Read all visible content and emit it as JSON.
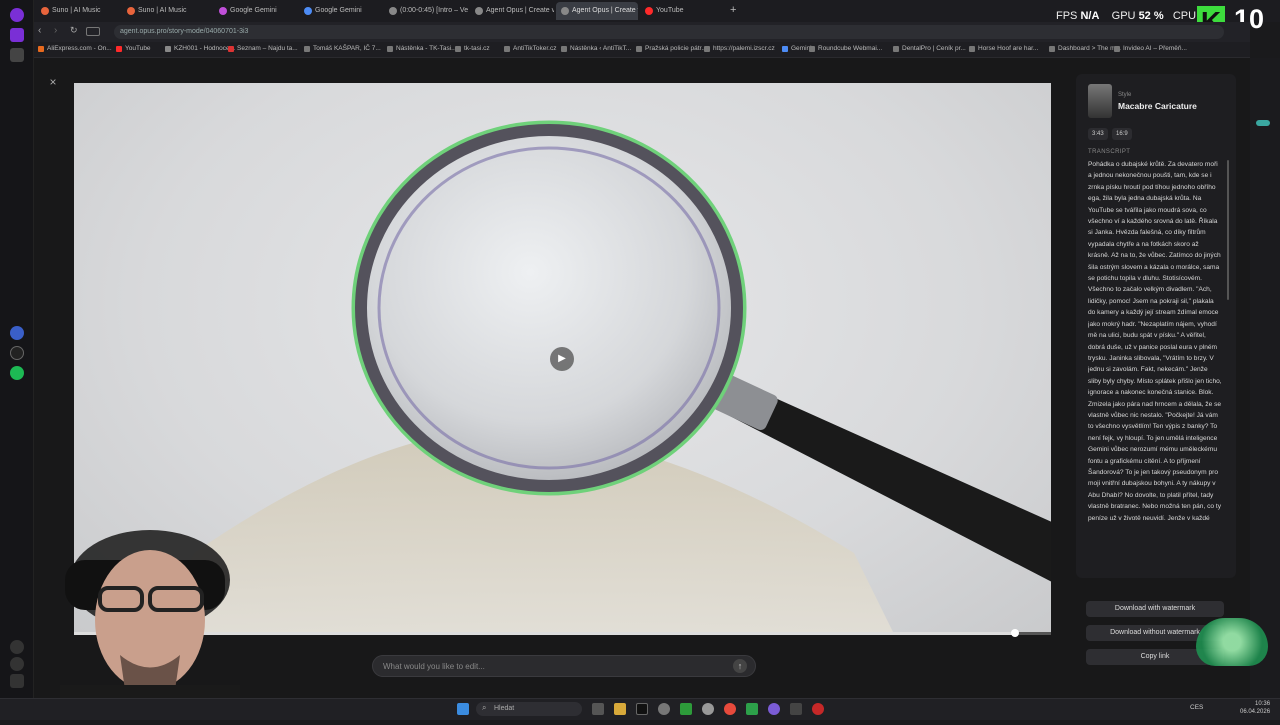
{
  "browser": {
    "tabs": [
      {
        "label": "Suno | AI Music",
        "color": "#e8643c"
      },
      {
        "label": "Suno | AI Music",
        "color": "#e8643c"
      },
      {
        "label": "Google Gemini",
        "color": "#c04fd9"
      },
      {
        "label": "Google Gemini",
        "color": "#4d8cf5"
      },
      {
        "label": "(0:00-0:45) [Intro – Vese]",
        "color": "#888"
      },
      {
        "label": "Agent Opus | Create vide",
        "color": "#888"
      },
      {
        "label": "Agent Opus | Create vide",
        "color": "#888"
      },
      {
        "label": "YouTube",
        "color": "#ff2a2a"
      }
    ],
    "url": "agent.opus.pro/story-mode/04060701-3i3",
    "bookmarks": [
      {
        "label": "AliExpress.com - On...",
        "color": "#e86a1e"
      },
      {
        "label": "YouTube",
        "color": "#ff2a2a"
      },
      {
        "label": "KZH001 - Hodnoce...",
        "color": "#888"
      },
      {
        "label": "Seznam – Najdu ta...",
        "color": "#d33"
      },
      {
        "label": "Tomáš KAŠPAR, IČ 7...",
        "color": "#777"
      },
      {
        "label": "Nástěnka - TK-Tasi...",
        "color": "#777"
      },
      {
        "label": "tk-tasi.cz",
        "color": "#777"
      },
      {
        "label": "AntiTikToker.cz",
        "color": "#777"
      },
      {
        "label": "Nástěnka ‹ AntiTikT...",
        "color": "#777"
      },
      {
        "label": "Pražská policie pátr...",
        "color": "#777"
      },
      {
        "label": "https://palemi.izscr.cz",
        "color": "#777"
      },
      {
        "label": "Gemini",
        "color": "#4d8cf5"
      },
      {
        "label": "Roundcube Webmai...",
        "color": "#777"
      },
      {
        "label": "DentalPro | Ceník pr...",
        "color": "#777"
      },
      {
        "label": "Horse Hoof are har...",
        "color": "#777"
      },
      {
        "label": "Dashboard > The m...",
        "color": "#777"
      },
      {
        "label": "Invideo AI – Přeměň...",
        "color": "#777"
      }
    ]
  },
  "hud": {
    "fps_label": "FPS",
    "fps_value": "N/A",
    "gpu_label": "GPU",
    "gpu_value": "52 %",
    "cpu_label": "CPU",
    "logo_letter": "K",
    "logo_number": "10"
  },
  "modal": {
    "close": "×",
    "play_icon": "play-icon",
    "progress": 0.963,
    "edit_placeholder": "What would you like to edit...",
    "send": "↑"
  },
  "sidebar": {
    "style_label": "Style",
    "style_name": "Macabre Caricature",
    "duration": "3:43",
    "ratio": "16:9",
    "transcript_label": "TRANSCRIPT",
    "transcript": "Pohádka o dubajské krůtě. Za devatero moři a jednou nekonečnou poušti, tam, kde se i zrnka písku hroutí pod tíhou jednoho obřího ega, žila byla jedna dubajská krůta. Na YouTube se tvářila jako moudrá sova, co všechno ví a každého srovná do latě. Říkala si Janka. Hvězda falešná, co díky filtrům vypadala chytře a na fotkách skoro až krásně. Až na to, že vůbec. Zatímco do jiných šila ostrým slovem a kázala o morálce, sama se potichu topila v dluhu. Stotisícovém. Všechno to začalo velkým divadlem. \"Ach, lidičky, pomoc! Jsem na pokraji sil,\" plakala do kamery a každý její stream ždímal emoce jako mokrý hadr. \"Nezaplatím nájem, vyhodí mě na ulici, budu spát v písku.\" A věřitel, dobrá duše, už v panice poslal eura v plném trysku. Janinka slibovala, \"Vrátím to brzy. V jednu si zavolám. Fakt, nekecám.\" Jenže sliby byly chyby. Místo splátek přišlo jen ticho, ignorace a nakonec konečná stanice. Blok. Zmizela jako pára nad hrncem a dělala, že se vlastně vůbec nic nestalo. \"Počkejte! Já vám to všechno vysvětlím! Ten výpis z banky? To není fejk, vy hloupí. To jen umělá inteligence Gemini vůbec nerozumí mému uměleckému fontu a grafickému cítění. A to příjmení Šandorová? To je jen takový pseudonym pro moji vnitřní dubajskou bohyni. A ty nákupy v Abu Dhabí? No dovolte, to platil přítel, tady vlastně bratranec. Nebo možná ten pán, co ty peníze už v životě neuvidí. Jenže v každé",
    "buttons": [
      "Download with watermark",
      "Download without watermark",
      "Copy link"
    ]
  },
  "taskbar": {
    "search_placeholder": "Hledat",
    "lang": "CES",
    "time": "10:36",
    "date": "06.04.2026"
  }
}
